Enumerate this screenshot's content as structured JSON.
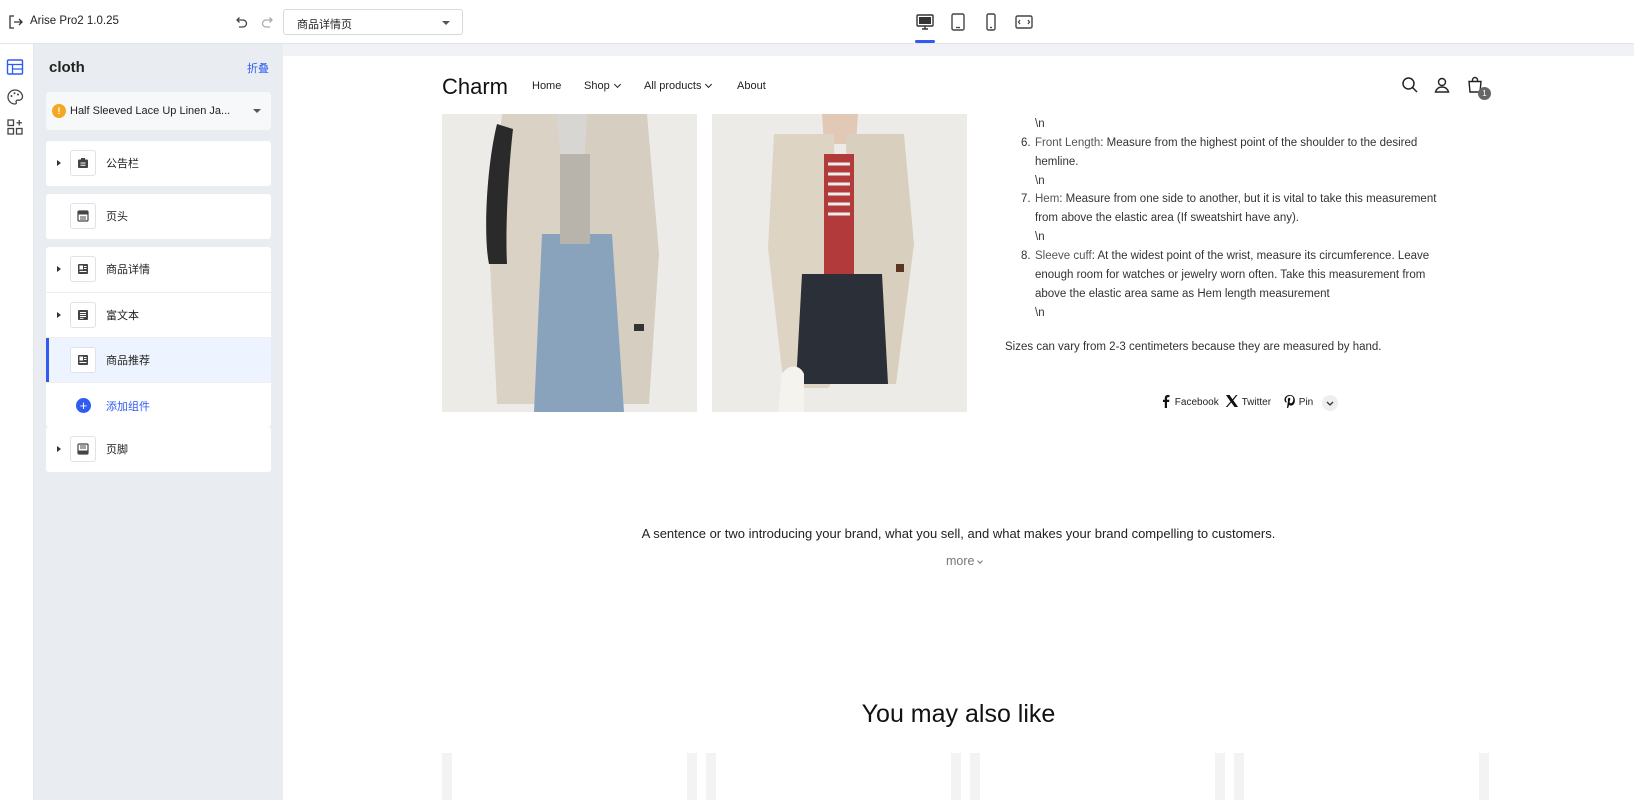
{
  "app": {
    "name": "Arise Pro2",
    "version": "1.0.25",
    "app_title": "Arise Pro2  1.0.25"
  },
  "toolbar": {
    "page_select": {
      "value": "商品详情页"
    },
    "devices": [
      {
        "name": "desktop",
        "active": true
      },
      {
        "name": "tablet",
        "active": false
      },
      {
        "name": "mobile",
        "active": false
      },
      {
        "name": "fullscreen",
        "active": false
      }
    ]
  },
  "rail": {
    "items": [
      "layout-icon",
      "palette-icon",
      "apps-icon"
    ]
  },
  "sidebar": {
    "site_name": "cloth",
    "collapse_label": "折叠",
    "product_select": {
      "value": "Half Sleeved Lace Up Linen Ja..."
    },
    "sections": [
      {
        "label": "公告栏",
        "icon": "announcement-icon",
        "expandable": true
      },
      {
        "label": "页头",
        "icon": "header-icon",
        "expandable": false
      },
      {
        "label": "商品详情",
        "icon": "product-detail-icon",
        "expandable": true
      },
      {
        "label": "富文本",
        "icon": "rich-text-icon",
        "expandable": true
      },
      {
        "label": "商品推荐",
        "icon": "product-recommend-icon",
        "expandable": false,
        "selected": true
      },
      {
        "label": "页脚",
        "icon": "footer-icon",
        "expandable": true
      }
    ],
    "add_component_label": "添加组件"
  },
  "store": {
    "logo": "Charm",
    "nav": {
      "home": "Home",
      "shop": "Shop",
      "all_products": "All products",
      "about": "About"
    },
    "cart_count": "1",
    "details": {
      "escape_text": "\\n",
      "item6": {
        "num": "6.",
        "term": "Front Length",
        "line1": ": Measure from the highest point of the shoulder to the desired",
        "line2": "hemline."
      },
      "item7": {
        "num": "7.",
        "term": "Hem",
        "line1": ": Measure from one side to another, but it is vital to take this measurement",
        "line2": "from above the elastic area (If sweatshirt have any)."
      },
      "item8": {
        "num": "8.",
        "term": "Sleeve cuff",
        "line1": ": At the widest point of the wrist, measure its circumference. Leave",
        "line2": "enough room for watches or jewelry worn often. Take this measurement from",
        "line3": "above the elastic area same as Hem length measurement"
      },
      "note": "Sizes can vary from 2-3 centimeters because they are measured by hand."
    },
    "share": {
      "facebook": "Facebook",
      "twitter": "Twitter",
      "pin": "Pin"
    },
    "brand_text": "A sentence or two introducing your brand, what you sell, and what makes your brand compelling to customers.",
    "more_label": "more",
    "recommend_title": "You may also like"
  },
  "colors": {
    "accent": "#2f5bf1",
    "warning": "#f5a623",
    "sidebar_bg": "#e9ecf1",
    "selected_row": "#eef4ff"
  }
}
